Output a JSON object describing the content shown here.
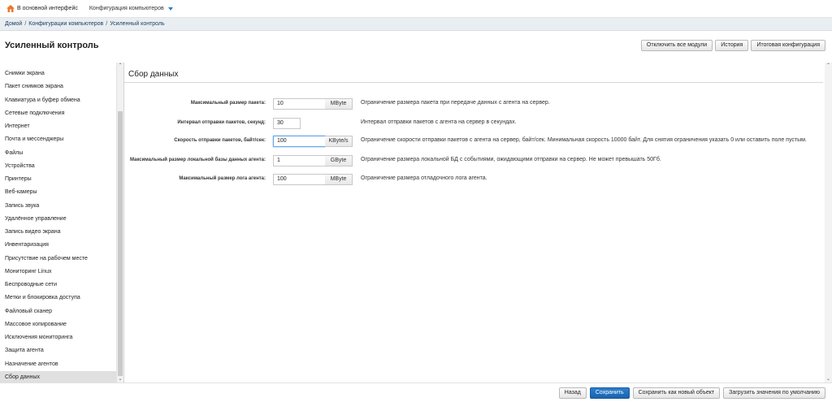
{
  "topbar": {
    "home_label": "В основной интерфейс",
    "config_menu_label": "Конфигурация компьютеров"
  },
  "breadcrumb": [
    "Домой",
    "Конфигурации компьютеров",
    "Усиленный контроль"
  ],
  "page": {
    "title": "Усиленный контроль",
    "buttons": {
      "disable_all": "Отключить все модули",
      "history": "История",
      "final_config": "Итоговая конфигурация"
    }
  },
  "sidebar": {
    "items": [
      {
        "label": "Снимки экрана"
      },
      {
        "label": "Пакет снимков экрана"
      },
      {
        "label": "Клавиатура и буфер обмена"
      },
      {
        "label": "Сетевые подключения"
      },
      {
        "label": "Интернет"
      },
      {
        "label": "Почта и мессенджеры"
      },
      {
        "label": "Файлы"
      },
      {
        "label": "Устройства"
      },
      {
        "label": "Принтеры"
      },
      {
        "label": "Веб-камеры"
      },
      {
        "label": "Запись звука"
      },
      {
        "label": "Удалённое управление"
      },
      {
        "label": "Запись видео экрана"
      },
      {
        "label": "Инвентаризация"
      },
      {
        "label": "Присутствие на рабочем месте"
      },
      {
        "label": "Мониторинг Linux"
      },
      {
        "label": "Беспроводные сети"
      },
      {
        "label": "Метки и блокировка доступа"
      },
      {
        "label": "Файловый сканер"
      },
      {
        "label": "Массовое копирование"
      },
      {
        "label": "Исключения мониторинга"
      },
      {
        "label": "Защита агента"
      },
      {
        "label": "Назначение агентов"
      },
      {
        "label": "Сбор данных",
        "active": true
      }
    ]
  },
  "section": {
    "title": "Сбор данных",
    "fields": [
      {
        "label": "Максимальный размер пакета:",
        "value": "10",
        "unit": "MByte",
        "description": "Ограничение размера пакета при передаче данных с агента на сервер."
      },
      {
        "label": "Интервал отправки пакетов, секунд:",
        "value": "30",
        "unit": "",
        "description": "Интервал отправки пакетов с агента на сервер в секундах."
      },
      {
        "label": "Скорость отправки пакетов, байт/сек:",
        "value": "100",
        "unit": "KByte/s",
        "description": "Ограничение скорости отправки пакетов с агента на сервер, байт/сек. Минимальная скорость 10000 байт. Для снятия ограничения указать 0 или оставить поле пустым."
      },
      {
        "label": "Максимальный размер локальной базы данных агента:",
        "value": "1",
        "unit": "GByte",
        "description": "Ограничение размера локальной БД с событиями, ожидающими отправки на сервер. Не может превышать 50Гб."
      },
      {
        "label": "Максимальный размер лога агента:",
        "value": "100",
        "unit": "MByte",
        "description": "Ограничение размера отладочного лога агента."
      }
    ]
  },
  "footer": {
    "back": "Назад",
    "save": "Сохранить",
    "save_as_new": "Сохранить как новый объект",
    "load_defaults": "Загрузить значения по умолчанию"
  },
  "colors": {
    "primary_button": "#1f6dbd",
    "breadcrumb_bg": "#e9eef2",
    "active_item_bg": "#e0e0e0"
  },
  "icons": {
    "home": "home-icon",
    "dropdown": "chevron-down-icon"
  }
}
